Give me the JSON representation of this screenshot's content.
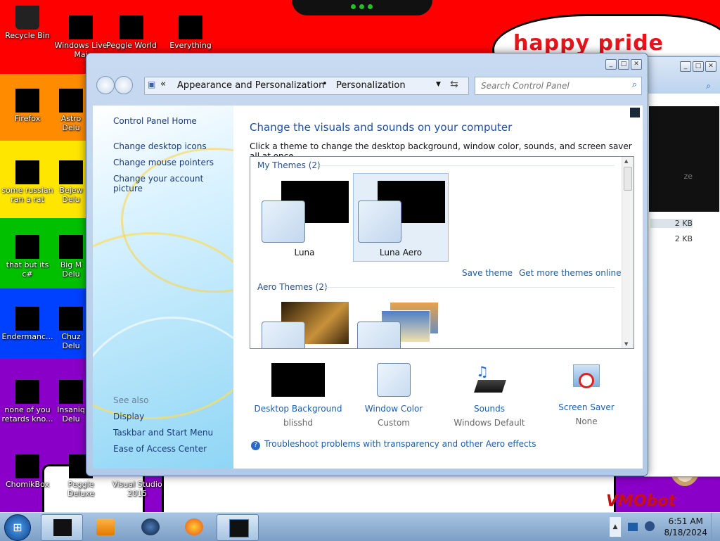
{
  "wallpaper": {
    "text": "happy pride month",
    "watermark": "VMObot"
  },
  "desktop_icons": [
    {
      "label": "Recycle Bin"
    },
    {
      "label": "Windows Live Mai"
    },
    {
      "label": "Peggle World"
    },
    {
      "label": "Everything"
    },
    {
      "label": "Firefox"
    },
    {
      "label": "Astro Delu"
    },
    {
      "label": "some russian ran a rat"
    },
    {
      "label": "Bejew Delu"
    },
    {
      "label": "that but its c#"
    },
    {
      "label": "Big M Delu"
    },
    {
      "label": "Endermanc..."
    },
    {
      "label": "Chuz Delu"
    },
    {
      "label": "none of you retards kno..."
    },
    {
      "label": "Insaniq Delu"
    },
    {
      "label": "ChomikBox"
    },
    {
      "label": "Peggle Deluxe"
    },
    {
      "label": "Visual Studio 2015"
    }
  ],
  "window": {
    "caption_buttons": [
      "_",
      "□",
      "✕"
    ],
    "breadcrumb": [
      "Appearance and Personalization",
      "Personalization"
    ],
    "search_placeholder": "Search Control Panel",
    "left_nav": {
      "home": "Control Panel Home",
      "links": [
        "Change desktop icons",
        "Change mouse pointers",
        "Change your account picture"
      ],
      "see_also_label": "See also",
      "see_also": [
        "Display",
        "Taskbar and Start Menu",
        "Ease of Access Center"
      ]
    },
    "heading": "Change the visuals and sounds on your computer",
    "subheading": "Click a theme to change the desktop background, window color, sounds, and screen saver all at once.",
    "my_themes_label": "My Themes (2)",
    "my_themes": [
      {
        "name": "Luna",
        "selected": false
      },
      {
        "name": "Luna Aero",
        "selected": true
      }
    ],
    "save_theme": "Save theme",
    "get_more_themes": "Get more themes online",
    "aero_themes_label": "Aero Themes (2)",
    "bottom_items": [
      {
        "label": "Desktop Background",
        "value": "blisshd",
        "icon": "desktop-background-icon"
      },
      {
        "label": "Window Color",
        "value": "Custom",
        "icon": "window-color-icon"
      },
      {
        "label": "Sounds",
        "value": "Windows Default",
        "icon": "sounds-icon"
      },
      {
        "label": "Screen Saver",
        "value": "None",
        "icon": "screen-saver-icon"
      }
    ],
    "troubleshoot": "Troubleshoot problems with transparency and other Aero effects"
  },
  "background_window": {
    "sizes": [
      "2 KB",
      "2 KB"
    ],
    "partial_label": "ze"
  },
  "taskbar": {
    "time": "6:51 AM",
    "date": "8/18/2024"
  }
}
